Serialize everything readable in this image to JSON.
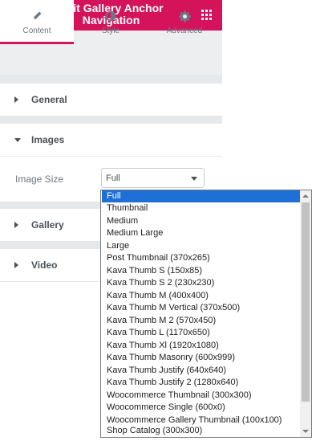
{
  "header": {
    "title_line1": "Edit Gallery Anchor",
    "title_line2": "Navigation",
    "menu_icon": "hamburger-icon",
    "apps_icon": "grid-icon"
  },
  "tabs": [
    {
      "label": "Content",
      "icon": "pencil-icon",
      "active": true
    },
    {
      "label": "Style",
      "icon": "half-circle-icon",
      "active": false
    },
    {
      "label": "Advanced",
      "icon": "gear-icon",
      "active": false
    }
  ],
  "sections": {
    "general": "General",
    "images": "Images",
    "gallery": "Gallery",
    "video": "Video"
  },
  "image_size": {
    "label": "Image Size",
    "value": "Full",
    "options": [
      "Full",
      "Thumbnail",
      "Medium",
      "Medium Large",
      "Large",
      "Post Thumbnail (370x265)",
      "Kava Thumb S (150x85)",
      "Kava Thumb S 2 (230x230)",
      "Kava Thumb M (400x400)",
      "Kava Thumb M Vertical (370x500)",
      "Kava Thumb M 2 (570x450)",
      "Kava Thumb L (1170x650)",
      "Kava Thumb Xl (1920x1080)",
      "Kava Thumb Masonry (600x999)",
      "Kava Thumb Justify (640x640)",
      "Kava Thumb Justify 2 (1280x640)",
      "Woocommerce Thumbnail (300x300)",
      "Woocommerce Single (600x0)",
      "Woocommerce Gallery Thumbnail (100x100)",
      "Shop Catalog (300x300)"
    ],
    "selected_index": 0
  },
  "colors": {
    "brand": "#d4135a",
    "selection": "#1e6fd6"
  }
}
